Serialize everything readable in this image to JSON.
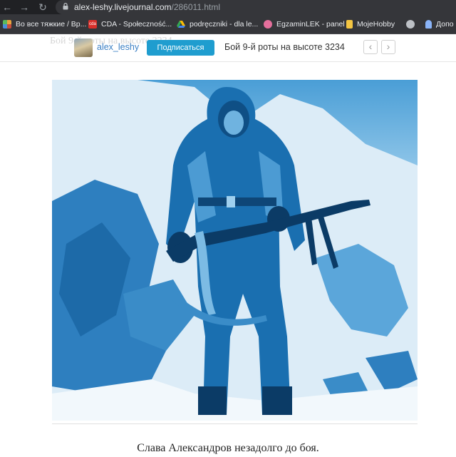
{
  "browser": {
    "url_host": "alex-leshy.livejournal.com",
    "url_path": "/286011.html",
    "bookmarks": [
      {
        "label": "Во все тяжкие / Вр...",
        "color": "#e8a33d",
        "icon": "tile-icon"
      },
      {
        "label": "CDA - Społeczność...",
        "color": "#d9302b",
        "icon": "cda-icon"
      },
      {
        "label": "podręczniki - dla le...",
        "color": "#34a853",
        "icon": "drive-icon"
      },
      {
        "label": "EgzaminLEK - panel",
        "color": "#e46f9c",
        "icon": "brain-icon"
      },
      {
        "label": "MojeHobby",
        "color": "#f4c542",
        "icon": "bookmark-icon"
      },
      {
        "label": "",
        "color": "#bdc1c6",
        "icon": "globe-icon"
      },
      {
        "label": "Допо",
        "color": "#8ab4f8",
        "icon": "person-icon"
      }
    ]
  },
  "lj": {
    "ghost_text": "Бой 9-й роты на высоте 3234",
    "author": "alex_leshy",
    "subscribe_label": "Подписаться",
    "post_title": "Бой 9-й роты на высоте 3234"
  },
  "post": {
    "caption": "Слава Александров незадолго до боя."
  },
  "colors": {
    "accent": "#1f9dcf",
    "link": "#3a7fc4",
    "photo_tint": "#1a7fc0"
  }
}
